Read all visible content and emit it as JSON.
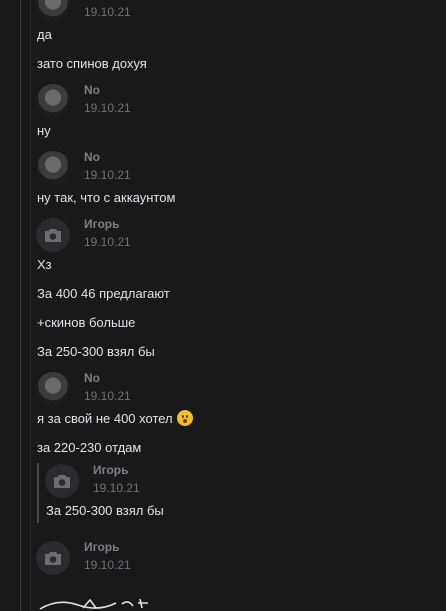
{
  "messages": [
    {
      "date": "19.10.21",
      "text": "да"
    },
    {
      "text": "зато спинов дохуя"
    },
    {
      "author": "No",
      "date": "19.10.21",
      "text": "ну"
    },
    {
      "author": "No",
      "date": "19.10.21",
      "text": "ну так, что с аккаунтом"
    },
    {
      "author": "Игорь",
      "date": "19.10.21",
      "lines": [
        "Хз",
        "За 400 46 предлагают",
        "+скинов больше",
        "За 250-300 взял бы"
      ]
    },
    {
      "author": "No",
      "date": "19.10.21",
      "lines": [
        "я за свой не 400 хотел",
        "за 220-230 отдам"
      ],
      "emoji": "hushed-face"
    },
    {
      "quote": {
        "author": "Игорь",
        "date": "19.10.21",
        "text": "За 250-300 взял бы"
      }
    },
    {
      "author": "Игорь",
      "date": "19.10.21"
    }
  ],
  "colors": {
    "background": "#19191a",
    "text": "#e1e3e6",
    "muted": "#7d7f83"
  }
}
